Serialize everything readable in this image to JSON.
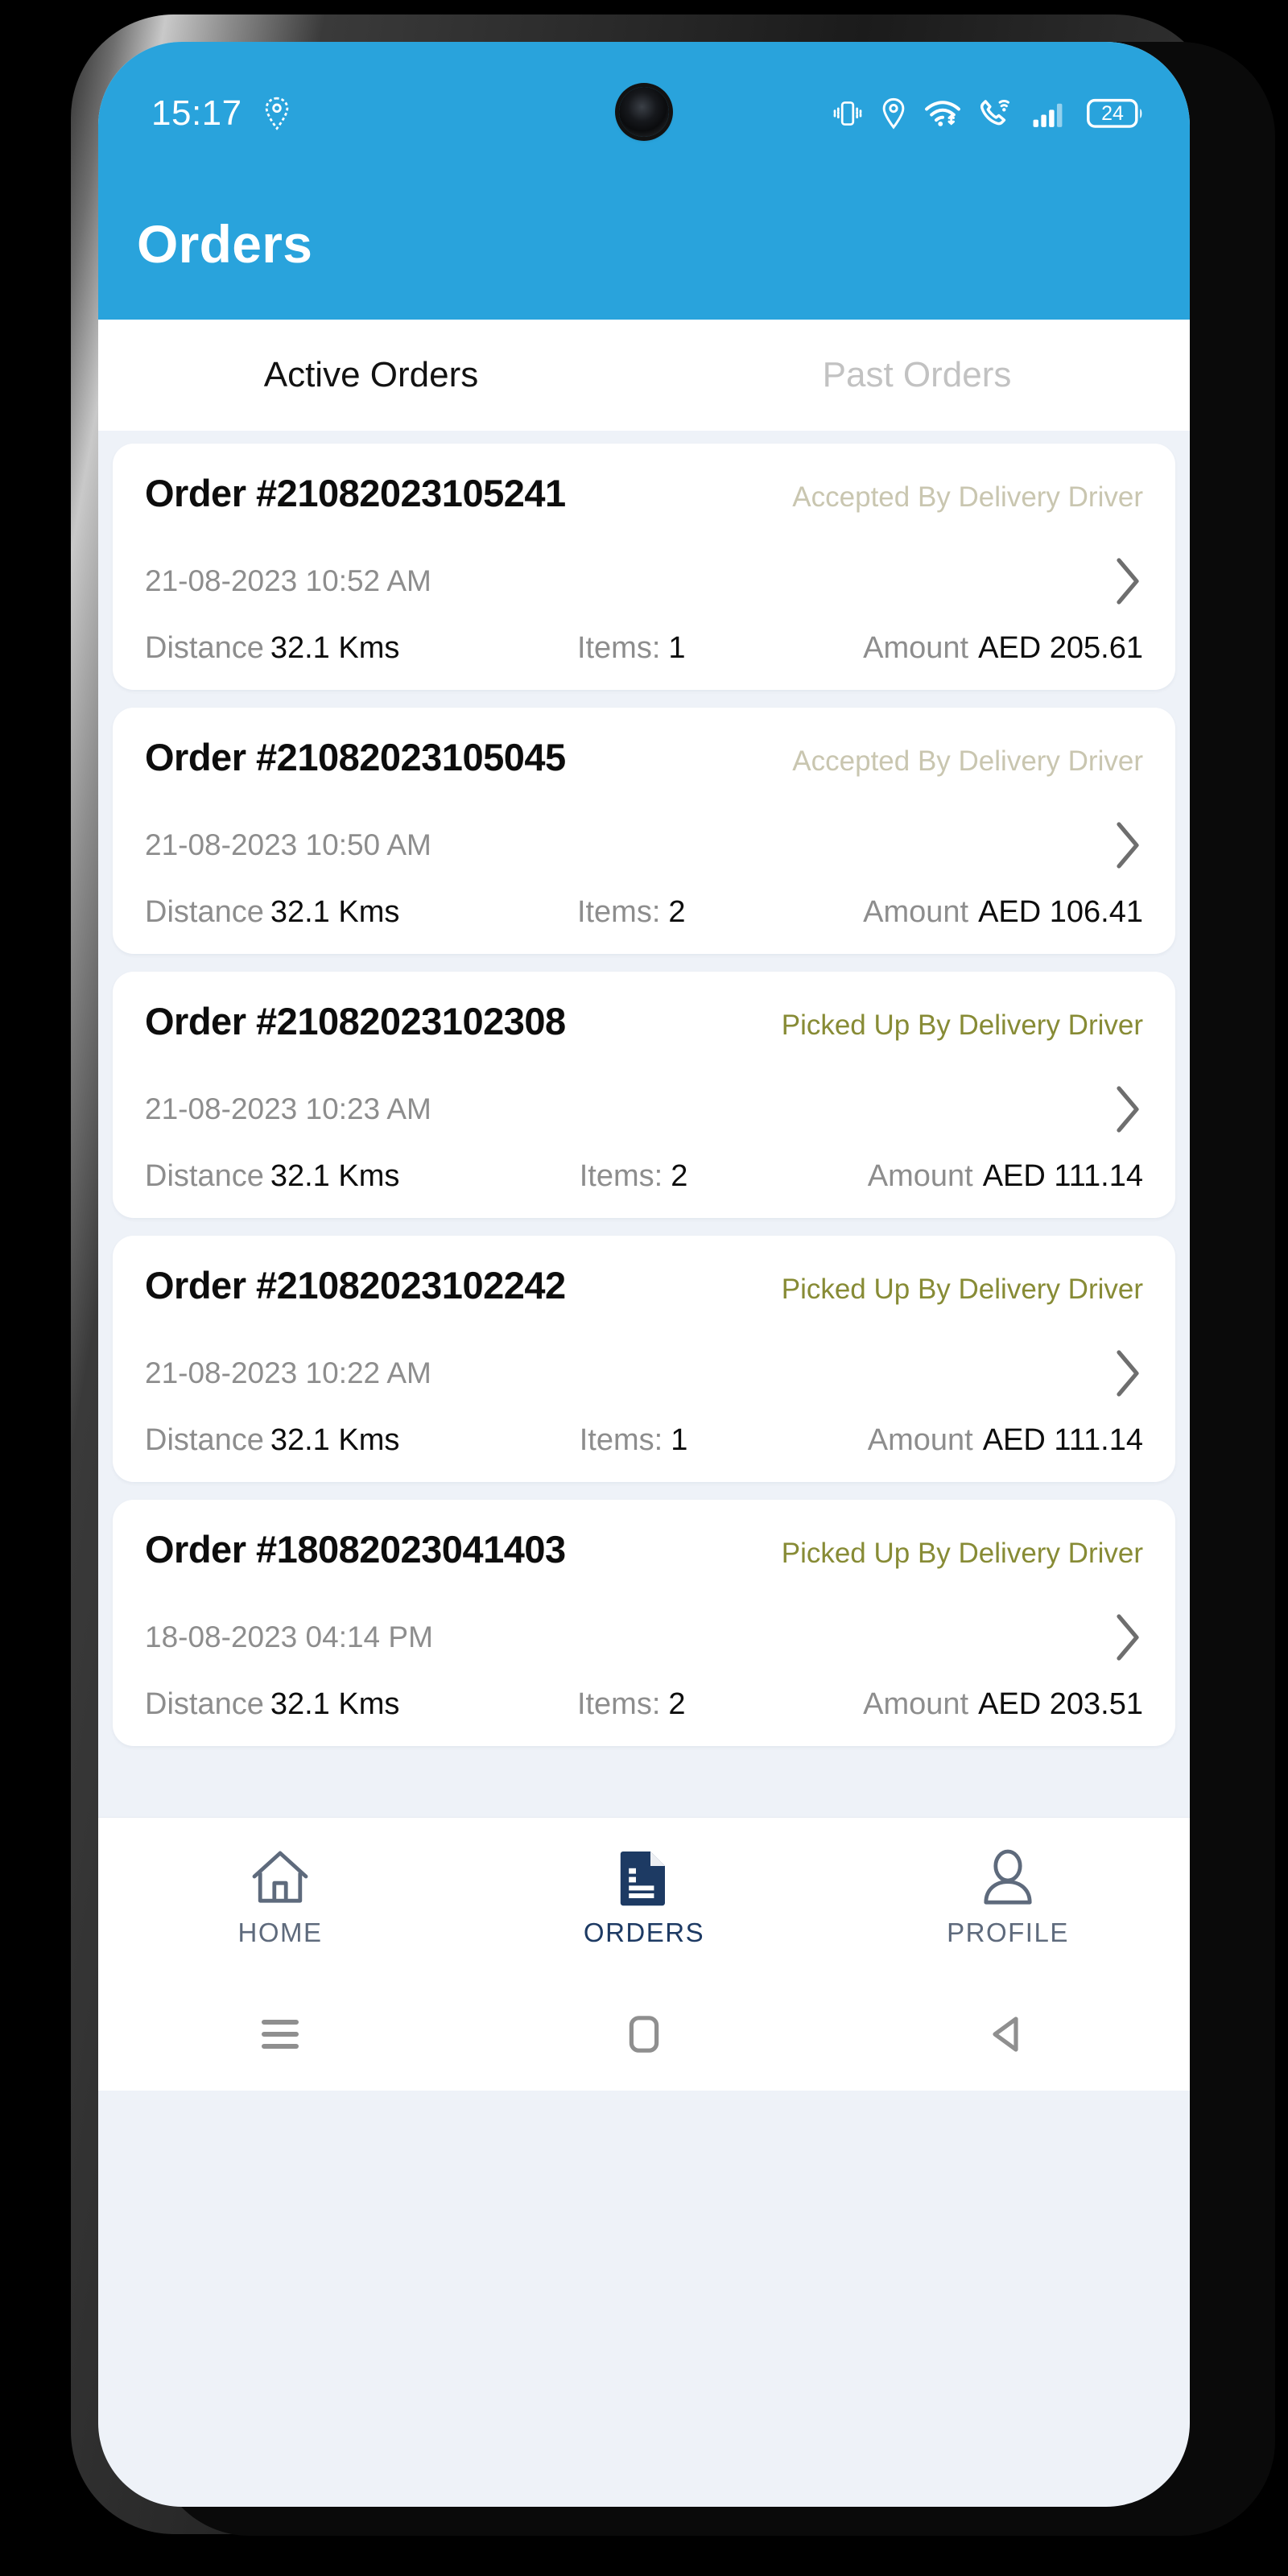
{
  "status_bar": {
    "time": "15:17",
    "battery_percent": "24",
    "icons": [
      "location-pin-icon",
      "vibrate-icon",
      "location-pin-icon",
      "wifi-icon",
      "wifi-calling-icon",
      "signal-bars-icon",
      "battery-icon"
    ]
  },
  "app_bar": {
    "title": "Orders",
    "background_color": "#29a3dc"
  },
  "tabs": [
    {
      "label": "Active Orders",
      "active": true
    },
    {
      "label": "Past Orders",
      "active": false
    }
  ],
  "labels": {
    "distance": "Distance",
    "items": "Items:",
    "amount": "Amount"
  },
  "status_colors": {
    "accepted": "#c9c6b0",
    "picked_up": "#878b35"
  },
  "orders": [
    {
      "order_id": "Order #21082023105241",
      "status": "Accepted By Delivery Driver",
      "status_type": "accepted",
      "datetime": "21-08-2023 10:52 AM",
      "distance": "32.1 Kms",
      "items": "1",
      "amount": "AED 205.61"
    },
    {
      "order_id": "Order #21082023105045",
      "status": "Accepted By Delivery Driver",
      "status_type": "accepted",
      "datetime": "21-08-2023 10:50 AM",
      "distance": "32.1 Kms",
      "items": "2",
      "amount": "AED 106.41"
    },
    {
      "order_id": "Order #21082023102308",
      "status": "Picked Up By Delivery Driver",
      "status_type": "picked",
      "datetime": "21-08-2023 10:23 AM",
      "distance": "32.1 Kms",
      "items": "2",
      "amount": "AED 111.14"
    },
    {
      "order_id": "Order #21082023102242",
      "status": "Picked Up By Delivery Driver",
      "status_type": "picked",
      "datetime": "21-08-2023 10:22 AM",
      "distance": "32.1 Kms",
      "items": "1",
      "amount": "AED 111.14"
    },
    {
      "order_id": "Order #18082023041403",
      "status": "Picked Up By Delivery Driver",
      "status_type": "picked",
      "datetime": "18-08-2023 04:14 PM",
      "distance": "32.1 Kms",
      "items": "2",
      "amount": "AED 203.51"
    }
  ],
  "bottom_nav": [
    {
      "label": "HOME",
      "icon": "home-icon",
      "active": false
    },
    {
      "label": "ORDERS",
      "icon": "document-icon",
      "active": true
    },
    {
      "label": "PROFILE",
      "icon": "person-icon",
      "active": false
    }
  ],
  "android_nav": [
    {
      "icon": "recents-icon"
    },
    {
      "icon": "home-square-icon"
    },
    {
      "icon": "back-triangle-icon"
    }
  ]
}
